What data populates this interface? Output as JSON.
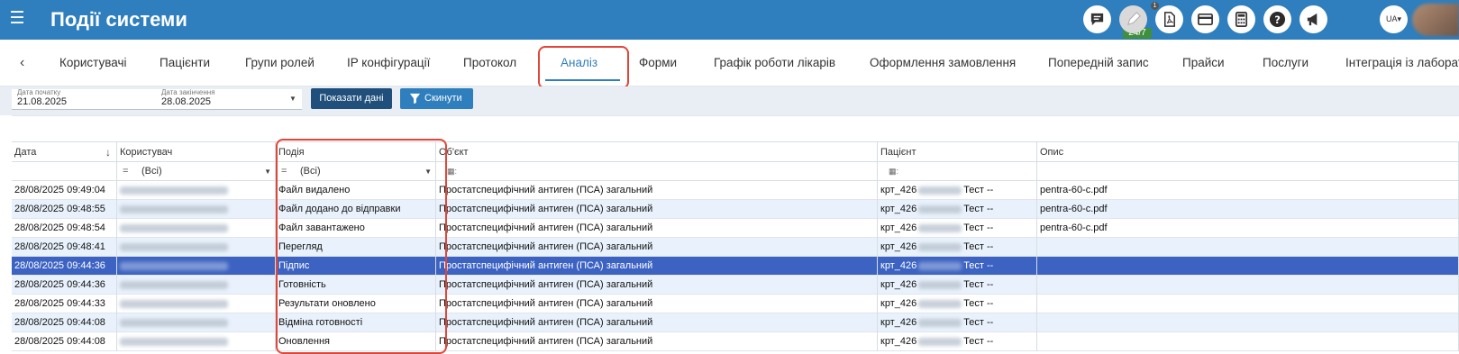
{
  "header": {
    "title": "Події системи",
    "support_badge": "24/7",
    "notification_count": "1",
    "language": "UA"
  },
  "tabs": [
    {
      "label": "Користувачі"
    },
    {
      "label": "Пацієнти"
    },
    {
      "label": "Групи ролей"
    },
    {
      "label": "IP конфігурації"
    },
    {
      "label": "Протокол"
    },
    {
      "label": "Аналіз",
      "active": true
    },
    {
      "label": "Форми"
    },
    {
      "label": "Графік роботи лікарів"
    },
    {
      "label": "Оформлення замовлення"
    },
    {
      "label": "Попередній запис"
    },
    {
      "label": "Прайси"
    },
    {
      "label": "Послуги"
    },
    {
      "label": "Інтеграція із лаборато"
    }
  ],
  "filters": {
    "date_from_label": "Дата початку",
    "date_from": "21.08.2025",
    "date_to_label": "Дата закінчення",
    "date_to": "28.08.2025",
    "show_button": "Показати дані",
    "reset_button": "Скинути"
  },
  "grid": {
    "columns": [
      "Дата",
      "Користувач",
      "Подія",
      "Об'єкт",
      "Пацієнт",
      "Опис"
    ],
    "filter_all": "(Всі)",
    "rows": [
      {
        "date": "28/08/2025 09:49:04",
        "event": "Файл видалено",
        "object": "Простатспецифічний антиген (ПСА) загальний",
        "patient_prefix": "крт_426",
        "patient_suffix": "Тест --",
        "description": "pentra-60-c.pdf",
        "selected": false
      },
      {
        "date": "28/08/2025 09:48:55",
        "event": "Файл додано до відправки",
        "object": "Простатспецифічний антиген (ПСА) загальний",
        "patient_prefix": "крт_426",
        "patient_suffix": "Тест --",
        "description": "pentra-60-c.pdf",
        "selected": false
      },
      {
        "date": "28/08/2025 09:48:54",
        "event": "Файл завантажено",
        "object": "Простатспецифічний антиген (ПСА) загальний",
        "patient_prefix": "крт_426",
        "patient_suffix": "Тест --",
        "description": "pentra-60-c.pdf",
        "selected": false
      },
      {
        "date": "28/08/2025 09:48:41",
        "event": "Перегляд",
        "object": "Простатспецифічний антиген (ПСА) загальний",
        "patient_prefix": "крт_426",
        "patient_suffix": "Тест --",
        "description": "",
        "selected": false
      },
      {
        "date": "28/08/2025 09:44:36",
        "event": "Підпис",
        "object": "Простатспецифічний антиген (ПСА) загальний",
        "patient_prefix": "крт_426",
        "patient_suffix": "Тест --",
        "description": "",
        "selected": true
      },
      {
        "date": "28/08/2025 09:44:36",
        "event": "Готовність",
        "object": "Простатспецифічний антиген (ПСА) загальний",
        "patient_prefix": "крт_426",
        "patient_suffix": "Тест --",
        "description": "",
        "selected": false
      },
      {
        "date": "28/08/2025 09:44:33",
        "event": "Результати оновлено",
        "object": "Простатспецифічний антиген (ПСА) загальний",
        "patient_prefix": "крт_426",
        "patient_suffix": "Тест --",
        "description": "",
        "selected": false
      },
      {
        "date": "28/08/2025 09:44:08",
        "event": "Відміна готовності",
        "object": "Простатспецифічний антиген (ПСА) загальний",
        "patient_prefix": "крт_426",
        "patient_suffix": "Тест --",
        "description": "",
        "selected": false
      },
      {
        "date": "28/08/2025 09:44:08",
        "event": "Оновлення",
        "object": "Простатспецифічний антиген (ПСА) загальний",
        "patient_prefix": "крт_426",
        "patient_suffix": "Тест --",
        "description": "",
        "selected": false
      }
    ]
  },
  "colors": {
    "header_bg": "#2f7ebd",
    "highlight": "#e0463a",
    "selected_row": "#3d63c2"
  }
}
